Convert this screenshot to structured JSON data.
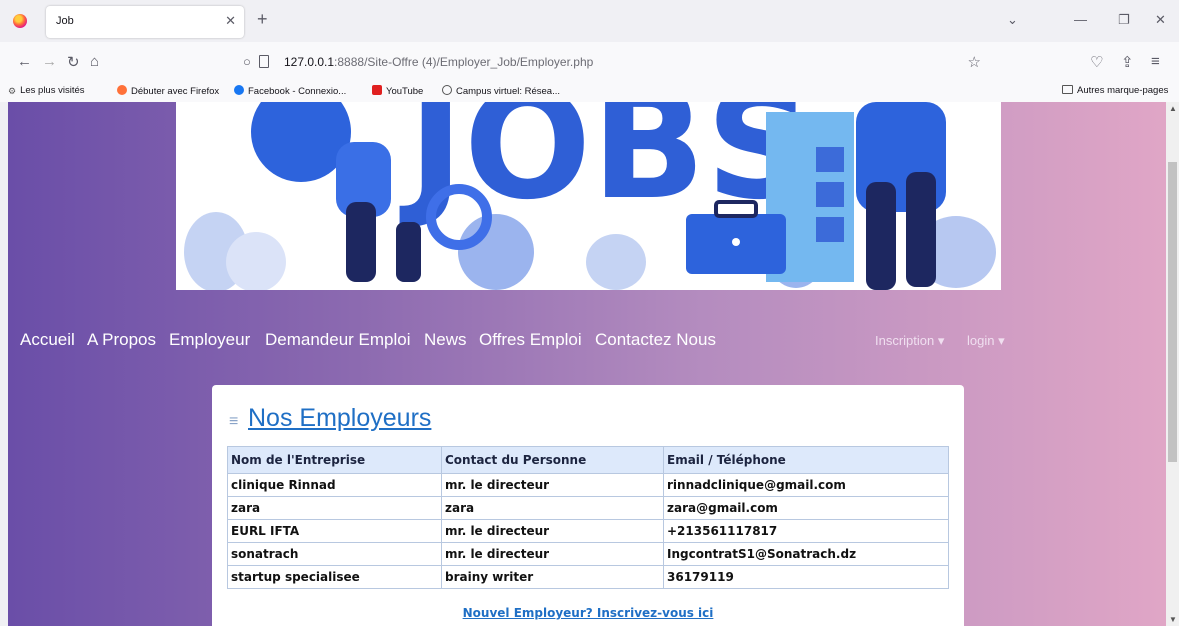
{
  "browser": {
    "tab_title": "Job",
    "url_host": "127.0.0.1",
    "url_path": ":8888/Site-Offre (4)/Employer_Job/Employer.php",
    "bookmarks": [
      {
        "label": "Les plus visités"
      },
      {
        "label": "Débuter avec Firefox"
      },
      {
        "label": "Facebook - Connexio..."
      },
      {
        "label": "YouTube"
      },
      {
        "label": "Campus virtuel: Résea..."
      }
    ],
    "other_bookmarks": "Autres marque-pages"
  },
  "banner": {
    "text": "JOBS"
  },
  "site_nav": {
    "items": [
      "Accueil",
      "A Propos",
      "Employeur",
      "Demandeur Emploi",
      "News",
      "Offres Emploi",
      "Contactez Nous"
    ],
    "inscription": "Inscription",
    "login": "login"
  },
  "employers": {
    "title": "Nos Employeurs",
    "headers": [
      "Nom de l'Entreprise",
      "Contact du Personne",
      "Email / Téléphone"
    ],
    "rows": [
      [
        "clinique Rinnad",
        "mr. le directeur",
        "rinnadclinique@gmail.com"
      ],
      [
        "zara",
        "zara",
        "zara@gmail.com"
      ],
      [
        "EURL IFTA",
        "mr. le directeur",
        "+213561117817"
      ],
      [
        "sonatrach",
        "mr. le directeur",
        "IngcontratS1@Sonatrach.dz"
      ],
      [
        "startup specialisee",
        "brainy writer",
        "36179119"
      ]
    ],
    "register_link": "Nouvel Employeur? Inscrivez-vous ici"
  },
  "colors": {
    "accent": "#1f6fc5",
    "gradient_left": "#6a4ea8",
    "gradient_right": "#e0a6c6"
  }
}
